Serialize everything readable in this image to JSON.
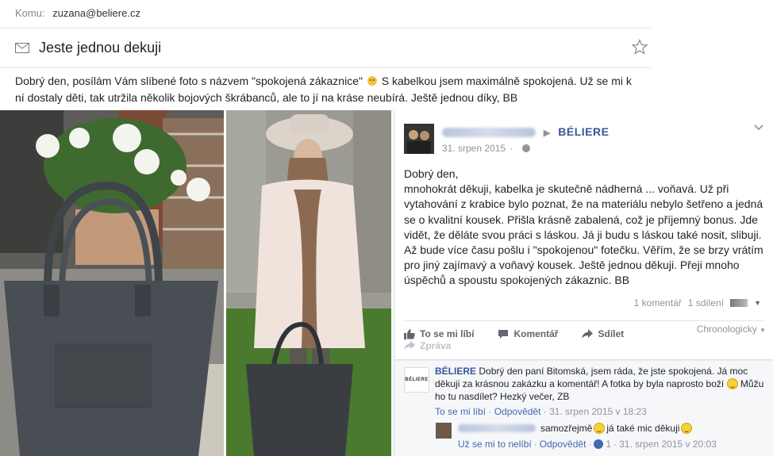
{
  "email": {
    "recipient_label": "Komu:",
    "recipient": "zuzana@beliere.cz",
    "subject": "Jeste jednou dekuji",
    "body_part1": "Dobrý den, posílám Vám slíbené foto s názvem \"spokojená zákaznice\"",
    "body_part2": "S kabelkou jsem maximálně spokojená. Už se mi k ní dostaly děti, tak utržila několik bojových škrábanců, ale to jí na kráse neubírá. Ještě jednou díky, BB"
  },
  "facebook": {
    "page_name": "BÉLIERE",
    "date": "31. srpen 2015",
    "post_text": "Dobrý den,\nmnohokrát děkuji, kabelka je skutečně nádherná ... voňavá. Už při vytahování z krabice bylo poznat, že na materiálu nebylo šetřeno a jedná se o kvalitní kousek. Přišla krásně zabalená, což je příjemný bonus. Jde vidět, že děláte svou práci s láskou. Já ji budu s láskou také nosit, slibuji. Až bude více času pošlu i \"spokojenou\" fotečku. Věřím, že se brzy vrátím pro jiný zajímavý a voňavý kousek. Ještě jednou děkuji. Přeji mnoho úspěchů a spoustu spokojených zákaznic. BB",
    "comment_count": "1 komentář",
    "share_count": "1 sdílení",
    "action_like": "To se mi líbí",
    "action_comment": "Komentář",
    "action_share": "Sdílet",
    "sort_label": "Chronologicky",
    "action_share2": "Zpráva",
    "comment": {
      "logo_text": "BÉLIERE",
      "author": "BÉLIERE",
      "text": "Dobrý den paní Bitomská, jsem ráda, že jste spokojená. Já moc děkuji za krásnou zakázku a komentář! A fotka by byla naprosto boží",
      "text2": "Můžu ho tu nasdílet? Hezký večer, ZB",
      "like_link": "To se mi líbí",
      "reply_link": "Odpovědět",
      "timestamp": "31. srpen 2015 v 18:23"
    },
    "reply": {
      "text1": "samozřejmě",
      "text2": "já také mic děkuji",
      "unlike_link": "Už se mi to nelíbí",
      "reply_link": "Odpovědět",
      "like_count": "1",
      "timestamp": "31. srpen 2015 v 20:03"
    }
  },
  "colors": {
    "fb_blue": "#365899",
    "link_blue": "#4267b2",
    "muted": "#90949c"
  }
}
